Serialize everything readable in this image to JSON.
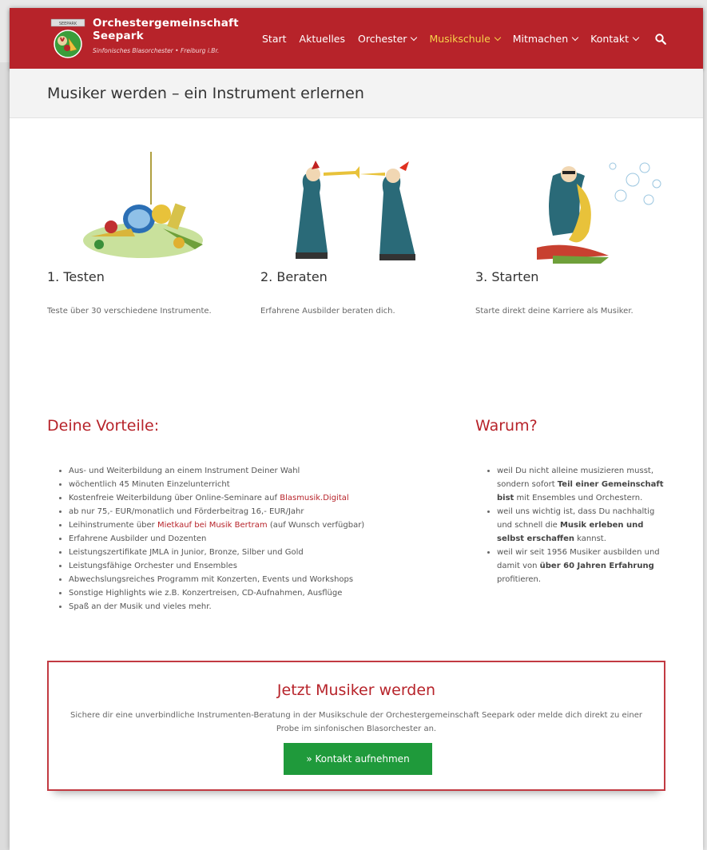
{
  "brand": {
    "name_line1": "Orchestergemeinschaft",
    "name_line2": "Seepark",
    "subtitle": "Sinfonisches Blasorchester • Freiburg i.Br.",
    "logo_banner": "SEEPARK"
  },
  "nav": {
    "items": [
      {
        "label": "Start",
        "dropdown": false
      },
      {
        "label": "Aktuelles",
        "dropdown": false
      },
      {
        "label": "Orchester",
        "dropdown": true
      },
      {
        "label": "Musikschule",
        "dropdown": true,
        "active": true
      },
      {
        "label": "Mitmachen",
        "dropdown": true
      },
      {
        "label": "Kontakt",
        "dropdown": true
      }
    ],
    "search_icon": "search-icon"
  },
  "page_title": "Musiker werden – ein Instrument erlernen",
  "steps": [
    {
      "title": "1. Testen",
      "desc": "Teste über 30 verschiedene Instrumente.",
      "illustration": "instruments-pile"
    },
    {
      "title": "2. Beraten",
      "desc": "Erfahrene Ausbilder beraten dich.",
      "illustration": "trumpet-players"
    },
    {
      "title": "3. Starten",
      "desc": "Starte direkt deine Karriere als Musiker.",
      "illustration": "saxophone-player"
    }
  ],
  "vorteile": {
    "heading": "Deine Vorteile:",
    "items": [
      {
        "text": "Aus- und Weiterbildung an einem Instrument Deiner Wahl"
      },
      {
        "text": "wöchentlich 45 Minuten Einzelunterricht"
      },
      {
        "text": "Kostenfreie Weiterbildung über Online-Seminare auf ",
        "link": "Blasmusik.Digital"
      },
      {
        "text": "ab nur 75,- EUR/monatlich und Förderbeitrag 16,- EUR/Jahr"
      },
      {
        "text": "Leihinstrumente über ",
        "link": "Mietkauf bei Musik Bertram",
        "after": " (auf Wunsch verfügbar)"
      },
      {
        "text": "Erfahrene Ausbilder und Dozenten"
      },
      {
        "text": "Leistungszertifikate JMLA in Junior, Bronze, Silber und Gold"
      },
      {
        "text": "Leistungsfähige Orchester und Ensembles"
      },
      {
        "text": "Abwechslungsreiches Programm mit Konzerten, Events und Workshops"
      },
      {
        "text": "Sonstige Highlights wie z.B. Konzertreisen, CD-Aufnahmen, Ausflüge"
      },
      {
        "text": "Spaß an der Musik und vieles mehr."
      }
    ]
  },
  "warum": {
    "heading": "Warum?",
    "items": [
      {
        "pre": "weil Du nicht alleine musizieren musst, sondern sofort ",
        "bold": "Teil einer Gemeinschaft bist",
        "post": " mit Ensembles und Orchestern."
      },
      {
        "pre": "weil uns wichtig ist, dass Du nachhaltig und schnell die ",
        "bold": "Musik erleben und selbst erschaffen",
        "post": " kannst."
      },
      {
        "pre": "weil wir seit 1956 Musiker ausbilden und damit von ",
        "bold": "über 60 Jahren Erfahrung",
        "post": " profitieren."
      }
    ]
  },
  "cta": {
    "title": "Jetzt Musiker werden",
    "text": "Sichere dir eine unverbindliche Instrumenten-Beratung in der Musikschule der Orchestergemeinschaft Seepark oder melde dich direkt zu einer Probe im sinfonischen Blasorchester an.",
    "button": "» Kontakt aufnehmen"
  },
  "colors": {
    "brand_red": "#b7232a",
    "nav_active": "#f7d34a",
    "cta_green": "#1f9a3b"
  }
}
